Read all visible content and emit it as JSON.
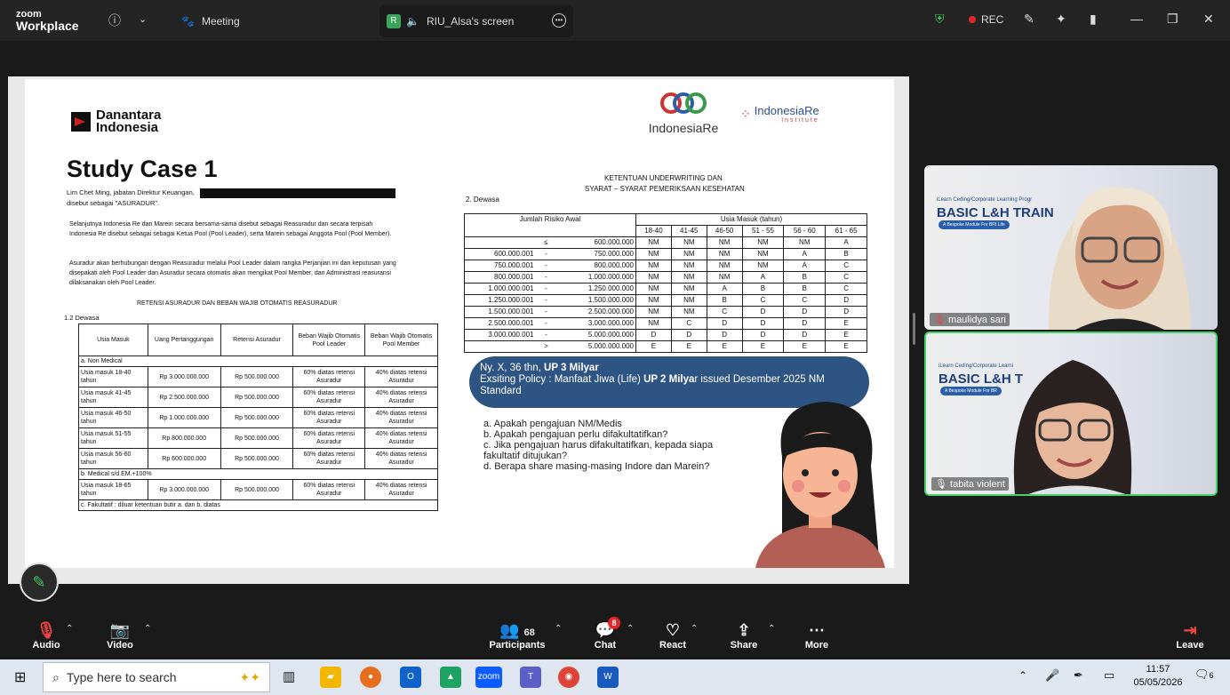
{
  "app": {
    "brand_top": "zoom",
    "brand_bottom": "Workplace"
  },
  "tabs": [
    {
      "label": "Meeting"
    },
    {
      "label": "RIU_Alsa's screen",
      "badge": "R"
    }
  ],
  "topright": {
    "rec": "REC"
  },
  "slide": {
    "logo_left": "Danantara Indonesia",
    "logo_mid": "IndonesiaRe",
    "logo_right": "IndonesiaRe",
    "logo_right_sub": "Institute",
    "title": "Study Case 1",
    "para1a": "Lim Chet Ming, jabatan Direktur Keuangan,",
    "para1b": "disebut sebagai \"ASURADUR\".",
    "para2": "Selanjutnya Indonesia Re dan Marein secara bersama-sama disebut sebagai Reasuradur dan secara terpisah Indonesia Re disebut sebagai sebagai Ketua Pool (Pool Leader), serta Marein sebagai Anggota Pool (Pool Member).",
    "para3": "Asuradur akan berhubungan dengan Reasuradur melalui Pool Leader dalam rangka Perjanjian ini dan keputusan yang disepakati oleh Pool Leader dan Asuradur secara otomatis akan mengikat Pool Member, dan Administrasi reasuransi dilaksanakan oleh Pool Leader.",
    "retensi_title": "RETENSI ASURADUR DAN BEBAN WAJIB OTOMATIS REASURADUR",
    "section": "1.2 Dewasa",
    "t1_headers": [
      "Usia Masuk",
      "Uang Pertanggungan",
      "Retensi Asuradur",
      "Beban Wajib Otomatis Pool Leader",
      "Beban Wajib Otomatis Pool Member"
    ],
    "t1_group_a": "a.  Non Medical",
    "t1_rows_a": [
      [
        "Usia masuk 18-40 tahun",
        "Rp 3.000.000.000",
        "Rp  500.000.000",
        "60% diatas retensi Asuradur",
        "40% diatas retensi Asuradur"
      ],
      [
        "Usia masuk 41-45 tahun",
        "Rp 2.500.000.000",
        "Rp  500.000.000",
        "60% diatas retensi Asuradur",
        "40% diatas retensi Asuradur"
      ],
      [
        "Usia masuk 46-50 tahun",
        "Rp 1.000.000.000",
        "Rp  500.000.000",
        "60% diatas retensi Asuradur",
        "40% diatas retensi Asuradur"
      ],
      [
        "Usia masuk 51-55 tahun",
        "Rp    800.000.000",
        "Rp  500.000.000",
        "60% diatas retensi Asuradur",
        "40% diatas retensi Asuradur"
      ],
      [
        "Usia masuk 56-60 tahun",
        "Rp   600.000.000",
        "Rp  500.000.000",
        "60% diatas retensi Asuradur",
        "40% diatas retensi Asuradur"
      ]
    ],
    "t1_group_b": "b.  Medical s/d EM.+100%",
    "t1_rows_b": [
      [
        "Usia masuk 18-65 tahun",
        "Rp 3.000.000.000",
        "Rp  500.000.000",
        "60% diatas retensi Asuradur",
        "40% diatas retensi Asuradur"
      ]
    ],
    "t1_footer": "c.  Fakultatif : diluar ketentuan butir a. dan b. diatas",
    "uw_title1": "KETENTUAN UNDERWRITING DAN",
    "uw_title2": "SYARAT – SYARAT PEMERIKSAAN KESEHATAN",
    "uw_section": "2.  Dewasa",
    "t2_head_left": "Jumlah Risiko Awal",
    "t2_head_right": "Usia Masuk (tahun)",
    "t2_ages": [
      "18-40",
      "41-45",
      "46-50",
      "51 - 55",
      "56 - 60",
      "61 - 65"
    ],
    "t2_rows": [
      [
        "",
        "≤",
        "600.000.000",
        "NM",
        "NM",
        "NM",
        "NM",
        "NM",
        "A"
      ],
      [
        "600.000.001",
        "-",
        "750.000.000",
        "NM",
        "NM",
        "NM",
        "NM",
        "A",
        "B"
      ],
      [
        "750.000.001",
        "-",
        "800.000.000",
        "NM",
        "NM",
        "NM",
        "NM",
        "A",
        "C"
      ],
      [
        "800.000.001",
        "-",
        "1.000.000.000",
        "NM",
        "NM",
        "NM",
        "A",
        "B",
        "C"
      ],
      [
        "1.000.000.001",
        "-",
        "1.250.000.000",
        "NM",
        "NM",
        "A",
        "B",
        "B",
        "C"
      ],
      [
        "1.250.000.001",
        "-",
        "1.500.000.000",
        "NM",
        "NM",
        "B",
        "C",
        "C",
        "D"
      ],
      [
        "1.500.000.001",
        "-",
        "2.500.000.000",
        "NM",
        "NM",
        "C",
        "D",
        "D",
        "D"
      ],
      [
        "2.500.000.001",
        "-",
        "3.000.000.000",
        "NM",
        "C",
        "D",
        "D",
        "D",
        "E"
      ],
      [
        "3.000.000.001",
        "-",
        "5.000.000.000",
        "D",
        "D",
        "D",
        "D",
        "D",
        "E"
      ],
      [
        "",
        ">",
        "5.000.000.000",
        "E",
        "E",
        "E",
        "E",
        "E",
        "E"
      ]
    ],
    "callout_l1a": "Ny. X, 36 thn, ",
    "callout_l1b": "UP 3 Milyar",
    "callout_l2a": "Exsiting Policy : Manfaat Jiwa (Life) ",
    "callout_l2b": "UP 2 Milya",
    "callout_l2c": "r issued Desember 2025 NM Standard",
    "questions": [
      "a. Apakah pengajuan NM/Medis",
      "b. Apakah pengajuan perlu difakultatifkan?",
      "c. Jika pengajuan harus difakultatifkan, kepada siapa fakultatif ditujukan?",
      "d. Berapa share masing-masing Indore dan Marein?"
    ]
  },
  "participants": [
    {
      "name": "maulidya sari",
      "slide_title": "BASIC L&H TRAIN",
      "slide_sub": "iLearn Ceding/Corporate Learning Progr",
      "slide_chip": "A Bespoke Module For BRI Life"
    },
    {
      "name": "tabita violent",
      "slide_title": "BASIC L&H T",
      "slide_sub": "iLearn Ceding/Corporate Learni",
      "slide_chip": "A Bespoke Module For BR"
    }
  ],
  "controls": {
    "audio": "Audio",
    "video": "Video",
    "participants": "Participants",
    "participants_count": "68",
    "chat": "Chat",
    "chat_badge": "8",
    "react": "React",
    "share": "Share",
    "more": "More",
    "leave": "Leave"
  },
  "taskbar": {
    "search_placeholder": "Type here to search",
    "time": "11:57",
    "date": "05/05/2026",
    "notif": "6"
  },
  "colors": {
    "accent": "#2e5483",
    "speaking": "#43d36a",
    "rec": "#e02828",
    "leave": "#e02828"
  }
}
